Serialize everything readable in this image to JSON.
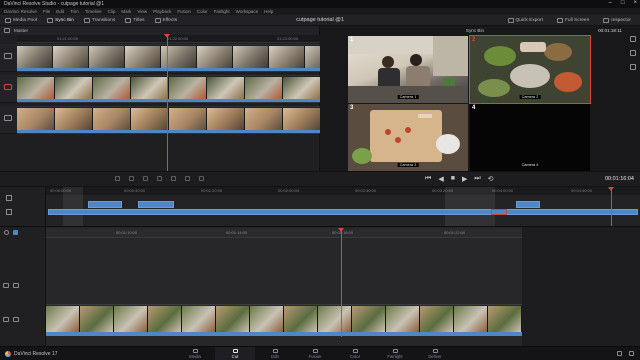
{
  "window": {
    "title": "DaVinci Resolve Studio - cutpage tutorial @1"
  },
  "menu": [
    "DaVinci Resolve",
    "File",
    "Edit",
    "Trim",
    "Timeline",
    "Clip",
    "Mark",
    "View",
    "Playback",
    "Fusion",
    "Color",
    "Fairlight",
    "Workspace",
    "Help"
  ],
  "toolbar": {
    "items": [
      "Media Pool",
      "Sync Bin",
      "Transitions",
      "Titles",
      "Effects"
    ],
    "project_title": "cutpage tutorial @1",
    "quick_export": "Quick Export",
    "full_screen": "Full Screen",
    "inspector": "Inspector"
  },
  "source": {
    "bin_label": "Master",
    "ruler": [
      "01:21:00:00",
      "01:22:00:00",
      "01:23:00:00"
    ]
  },
  "sync_bin": {
    "title": "Sync Bin",
    "timecode": "00:01:18:11",
    "cameras": [
      {
        "num": "1",
        "label": "Camera 1"
      },
      {
        "num": "2",
        "label": "Camera 2"
      },
      {
        "num": "3",
        "label": "Camera 3"
      },
      {
        "num": "4",
        "label": "Camera 4"
      }
    ]
  },
  "transport": {
    "timecode": "00:01:16:04"
  },
  "upper_timeline": {
    "ruler": [
      "00:00:00:00",
      "00:00:40:00",
      "00:01:20:00",
      "00:02:00:00",
      "00:02:40:00",
      "00:03:20:00",
      "00:04:00:00",
      "00:04:40:00"
    ]
  },
  "lower_timeline": {
    "ruler": [
      "00:01:10:00",
      "00:01:14:00",
      "00:01:18:00",
      "00:01:22:00"
    ]
  },
  "pages": [
    "Media",
    "Cut",
    "Edit",
    "Fusion",
    "Color",
    "Fairlight",
    "Deliver"
  ],
  "active_page": "Cut",
  "brand": "DaVinci Resolve 17",
  "colors": {
    "accent": "#4f86c6",
    "playhead": "#e0423a",
    "selected_cam": "#e0423a"
  }
}
